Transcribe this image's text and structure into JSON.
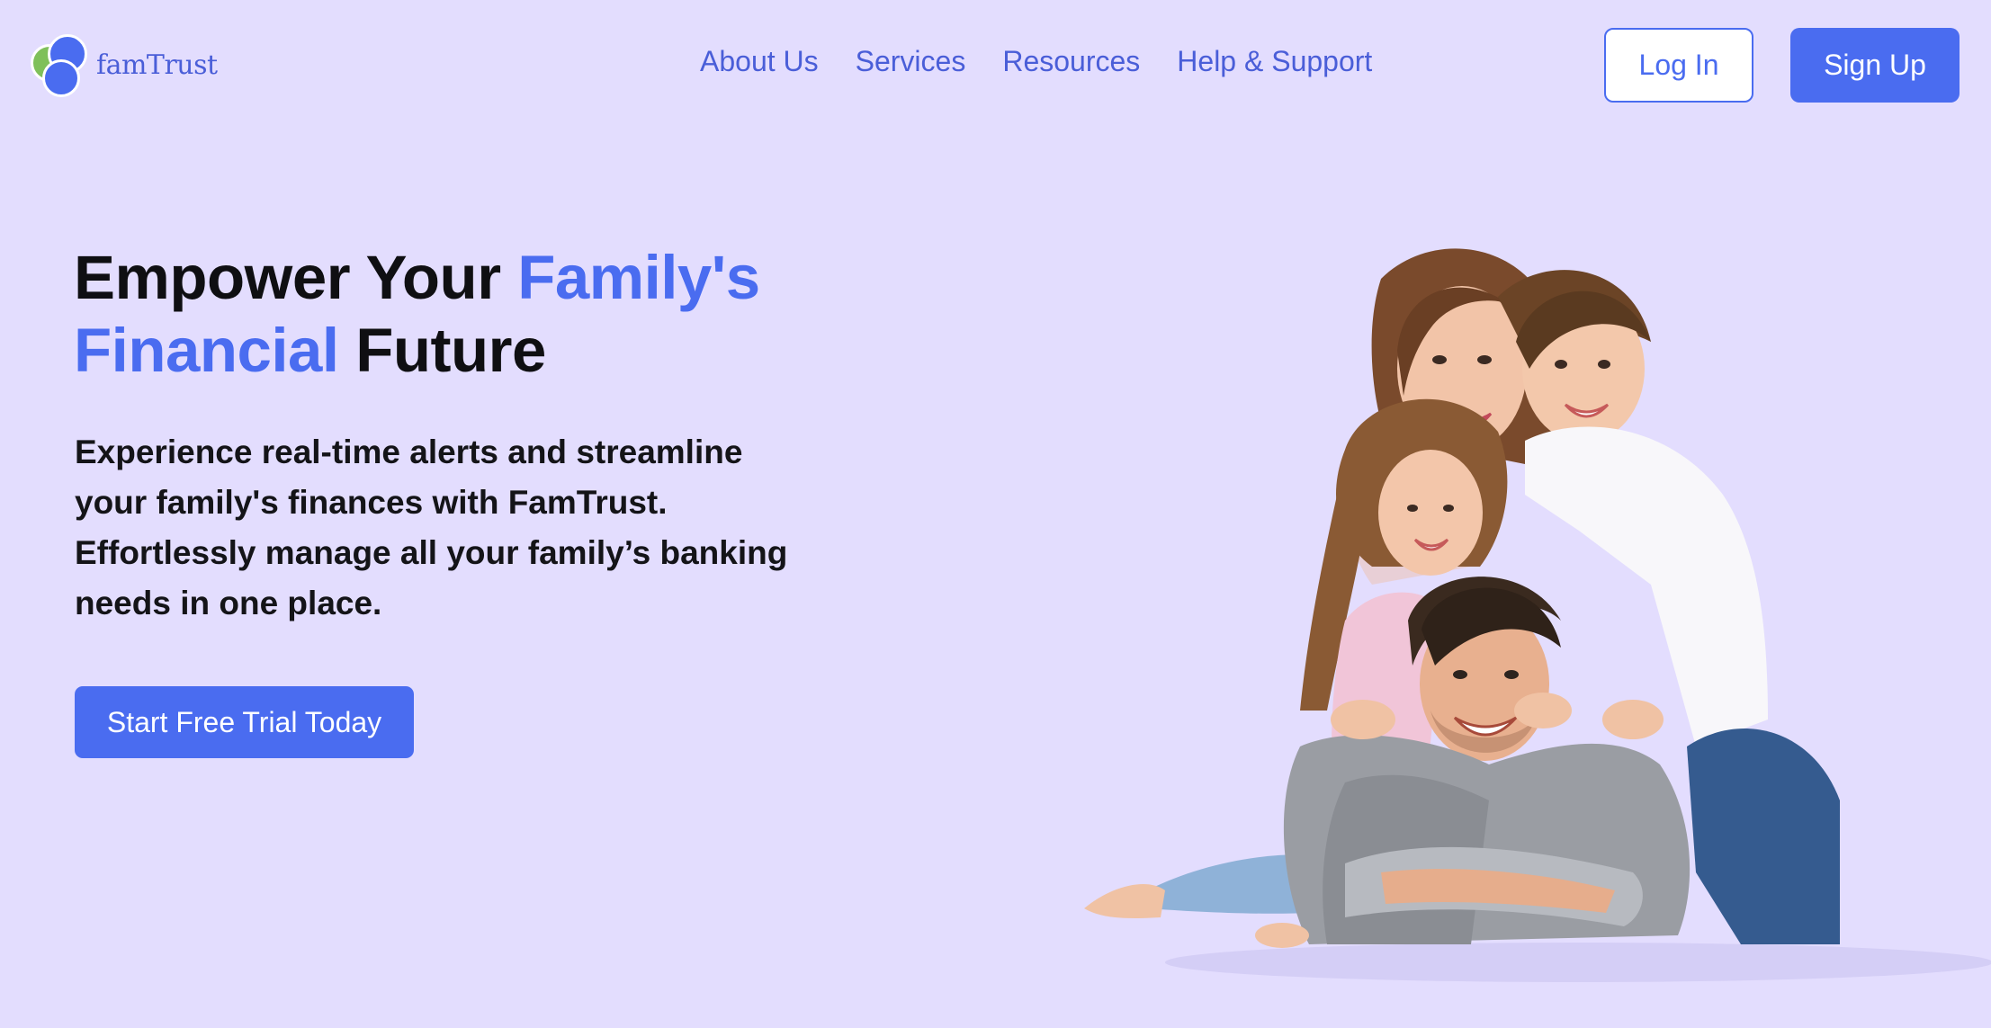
{
  "brand": {
    "name": "famTrust",
    "colors": {
      "accent": "#4a6cf0",
      "logo_green": "#7fc05a",
      "background": "#e3ddfe"
    }
  },
  "nav": {
    "items": [
      {
        "label": "About Us"
      },
      {
        "label": "Services"
      },
      {
        "label": "Resources"
      },
      {
        "label": "Help & Support"
      }
    ]
  },
  "auth": {
    "login_label": "Log In",
    "signup_label": "Sign Up"
  },
  "hero": {
    "title_part1": "Empower Your ",
    "title_accent1": "Family's",
    "title_accent2": "Financial",
    "title_part2": " Future",
    "description": "Experience real-time alerts and streamline your family's finances with FamTrust. Effortlessly manage all your family’s banking needs in one place.",
    "cta_label": "Start Free Trial Today",
    "image": "family-photo"
  }
}
